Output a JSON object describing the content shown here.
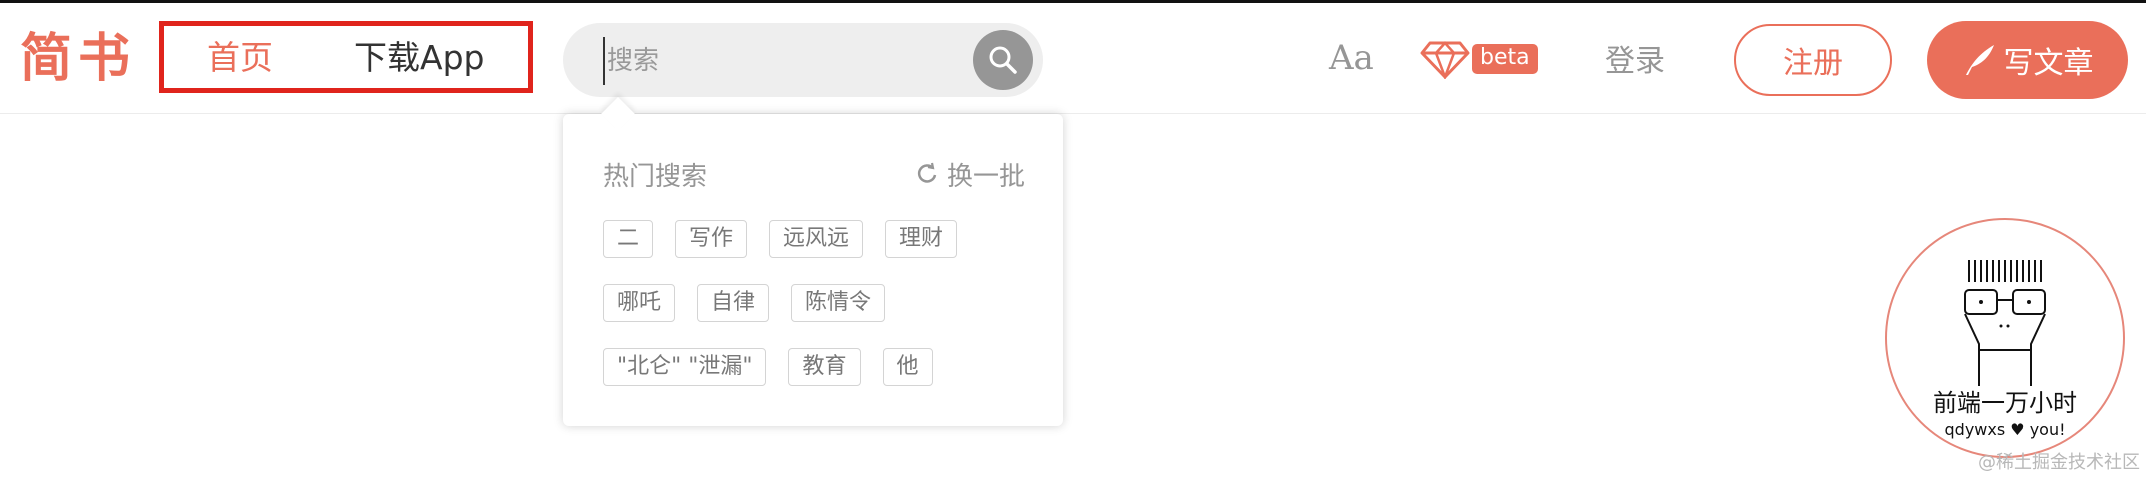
{
  "header": {
    "logo": "简书",
    "nav": {
      "home": "首页",
      "download_app": "下载App"
    },
    "search": {
      "placeholder": "搜索",
      "value": ""
    },
    "font_toggle": "Aa",
    "beta_badge": "beta",
    "login": "登录",
    "register": "注册",
    "write": "写文章"
  },
  "hot_search": {
    "title": "热门搜索",
    "refresh": "换一批",
    "tags": [
      [
        "二",
        "写作",
        "远风远",
        "理财"
      ],
      [
        "哪吒",
        "自律",
        "陈情令"
      ],
      [
        "\"北仑\" \"泄漏\"",
        "教育",
        "他"
      ]
    ]
  },
  "avatar": {
    "title": "前端一万小时",
    "subtitle": "qdywxs ♥ you!"
  },
  "watermark": "@稀土掘金技术社区",
  "colors": {
    "brand": "#ea6f5a",
    "highlight_box": "#e0241c",
    "muted": "#969696",
    "search_bg": "#eeeeee"
  }
}
